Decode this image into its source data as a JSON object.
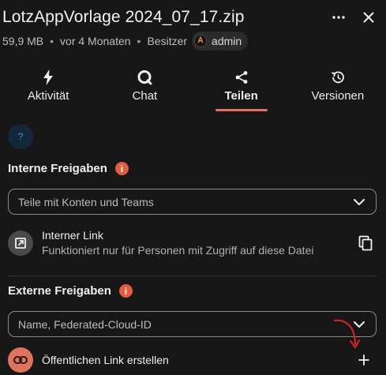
{
  "header": {
    "title": "LotzAppVorlage 2024_07_17.zip",
    "size": "59,9 MB",
    "modified": "vor 4 Monaten",
    "owner_label": "Besitzer",
    "owner_initial": "A",
    "owner_name": "admin",
    "actions": [
      {
        "icon": "more-horizontal-icon"
      },
      {
        "icon": "close-icon"
      }
    ]
  },
  "tabs": [
    {
      "label": "Aktivität",
      "icon": "lightning-icon",
      "active": false
    },
    {
      "label": "Chat",
      "icon": "chat-bubble-icon",
      "active": false
    },
    {
      "label": "Teilen",
      "icon": "share-icon",
      "active": true
    },
    {
      "label": "Versionen",
      "icon": "history-icon",
      "active": false
    }
  ],
  "help": {
    "label": "?"
  },
  "internal": {
    "title": "Interne Freigaben",
    "info": "i",
    "search_placeholder": "Teile mit Konten und Teams",
    "link_title": "Interner Link",
    "link_sub": "Funktioniert nur für Personen mit Zugriff auf diese Datei"
  },
  "external": {
    "title": "Externe Freigaben",
    "info": "i",
    "search_placeholder": "Name, Federated-Cloud-ID",
    "public_link_label": "Öffentlichen Link erstellen"
  },
  "colors": {
    "background": "#171717",
    "accent": "#e0735e",
    "info_badge": "#e35d3e",
    "help_bg": "#14283a",
    "annotation_arrow": "#e02020"
  }
}
